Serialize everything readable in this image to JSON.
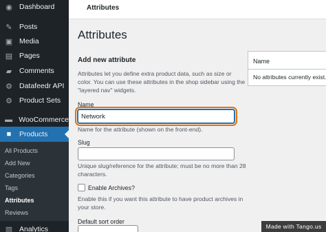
{
  "sidebar": {
    "items": [
      {
        "label": "Dashboard",
        "icon": "dashboard-icon",
        "glyph": "◉"
      },
      {
        "label": "Posts",
        "icon": "pin-icon",
        "glyph": "✎"
      },
      {
        "label": "Media",
        "icon": "media-icon",
        "glyph": "▣"
      },
      {
        "label": "Pages",
        "icon": "pages-icon",
        "glyph": "▤"
      },
      {
        "label": "Comments",
        "icon": "comments-icon",
        "glyph": "▰"
      },
      {
        "label": "Datafeedr API",
        "icon": "datafeedr-icon",
        "glyph": "⚙"
      },
      {
        "label": "Product Sets",
        "icon": "product-sets-icon",
        "glyph": "⚙"
      },
      {
        "label": "WooCommerce",
        "icon": "woocommerce-icon",
        "glyph": "▬"
      },
      {
        "label": "Products",
        "icon": "products-icon",
        "glyph": "■"
      },
      {
        "label": "Analytics",
        "icon": "analytics-icon",
        "glyph": "▥"
      }
    ],
    "submenu": [
      "All Products",
      "Add New",
      "Categories",
      "Tags",
      "Attributes",
      "Reviews"
    ]
  },
  "topbar": {
    "title": "Attributes"
  },
  "page": {
    "title": "Attributes"
  },
  "form": {
    "section_title": "Add new attribute",
    "description": "Attributes let you define extra product data, such as size or color. You can use these attributes in the shop sidebar using the \"layered nav\" widgets.",
    "name_label": "Name",
    "name_value": "Network",
    "name_help": "Name for the attribute (shown on the front-end).",
    "slug_label": "Slug",
    "slug_value": "",
    "slug_help": "Unique slug/reference for the attribute; must be no more than 28 characters.",
    "archives_label": "Enable Archives?",
    "archives_help": "Enable this if you want this attribute to have product archives in your store.",
    "archives_checked": false,
    "sort_label": "Default sort order"
  },
  "table": {
    "header": "Name",
    "empty_message": "No attributes currently exist."
  },
  "watermark": "Made with Tango.us",
  "colors": {
    "sidebar_bg": "#1d2327",
    "active": "#2271b1",
    "highlight": "#e8710a",
    "page_bg": "#f0f0f1"
  }
}
